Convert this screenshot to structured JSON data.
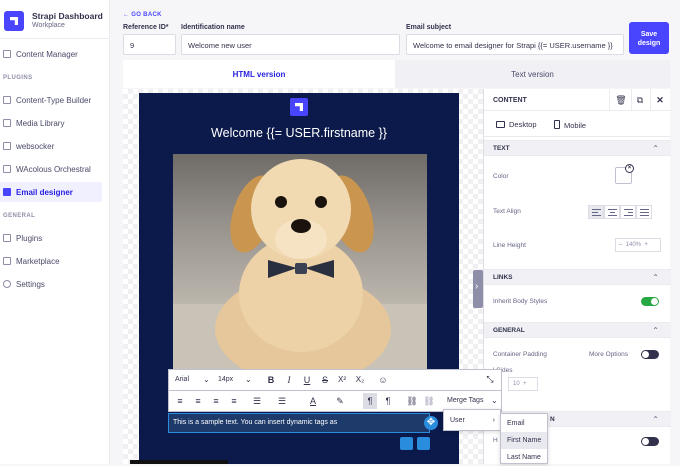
{
  "brand": {
    "title": "Strapi Dashboard",
    "subtitle": "Workplace"
  },
  "nav": {
    "content_manager": "Content Manager",
    "plugins_header": "PLUGINS",
    "plugins": [
      "Content-Type Builder",
      "Media Library",
      "websocker",
      "WAcolous Orchestral",
      "Email designer"
    ],
    "active": "Email designer",
    "general_header": "GENERAL",
    "general": [
      "Plugins",
      "Marketplace",
      "Settings"
    ]
  },
  "form": {
    "go_back": "GO BACK",
    "reference_label": "Reference ID*",
    "reference_value": "9",
    "name_label": "Identification name",
    "name_value": "Welcome new user",
    "subject_label": "Email subject",
    "subject_value": "Welcome to email designer for Strapi {{= USER.username }}",
    "save_label": "Save design"
  },
  "tabs": {
    "html": "HTML version",
    "text": "Text version"
  },
  "email": {
    "title": "Welcome {{= USER.firstname }}",
    "body_text": "This is a sample text. You can insert dynamic tags as"
  },
  "toolbar": {
    "font": "Arial",
    "size": "14px",
    "merge_tags": "Merge Tags",
    "user_item": "User",
    "submenu": [
      "Email",
      "First Name",
      "Last Name"
    ],
    "highlighted": "First Name"
  },
  "panel": {
    "title": "CONTENT",
    "desktop": "Desktop",
    "mobile": "Mobile",
    "text_group": "TEXT",
    "color_label": "Color",
    "align_label": "Text Align",
    "line_height_label": "Line Height",
    "line_height_value": "140%",
    "links_group": "LINKS",
    "inherit_label": "Inherit Body Styles",
    "inherit_on": true,
    "general_group": "GENERAL",
    "padding_label": "Container Padding",
    "more_options": "More Options",
    "more_options_on": false,
    "all_sides": "l Sides",
    "padding_value": "10",
    "hidden_group_tail": "N",
    "hidden_row_tail": "H"
  },
  "colors": {
    "accent": "#4945ff",
    "email_bg": "#0b1a4a",
    "toggle_on": "#28a745",
    "editor_border": "#2a8cdd"
  }
}
